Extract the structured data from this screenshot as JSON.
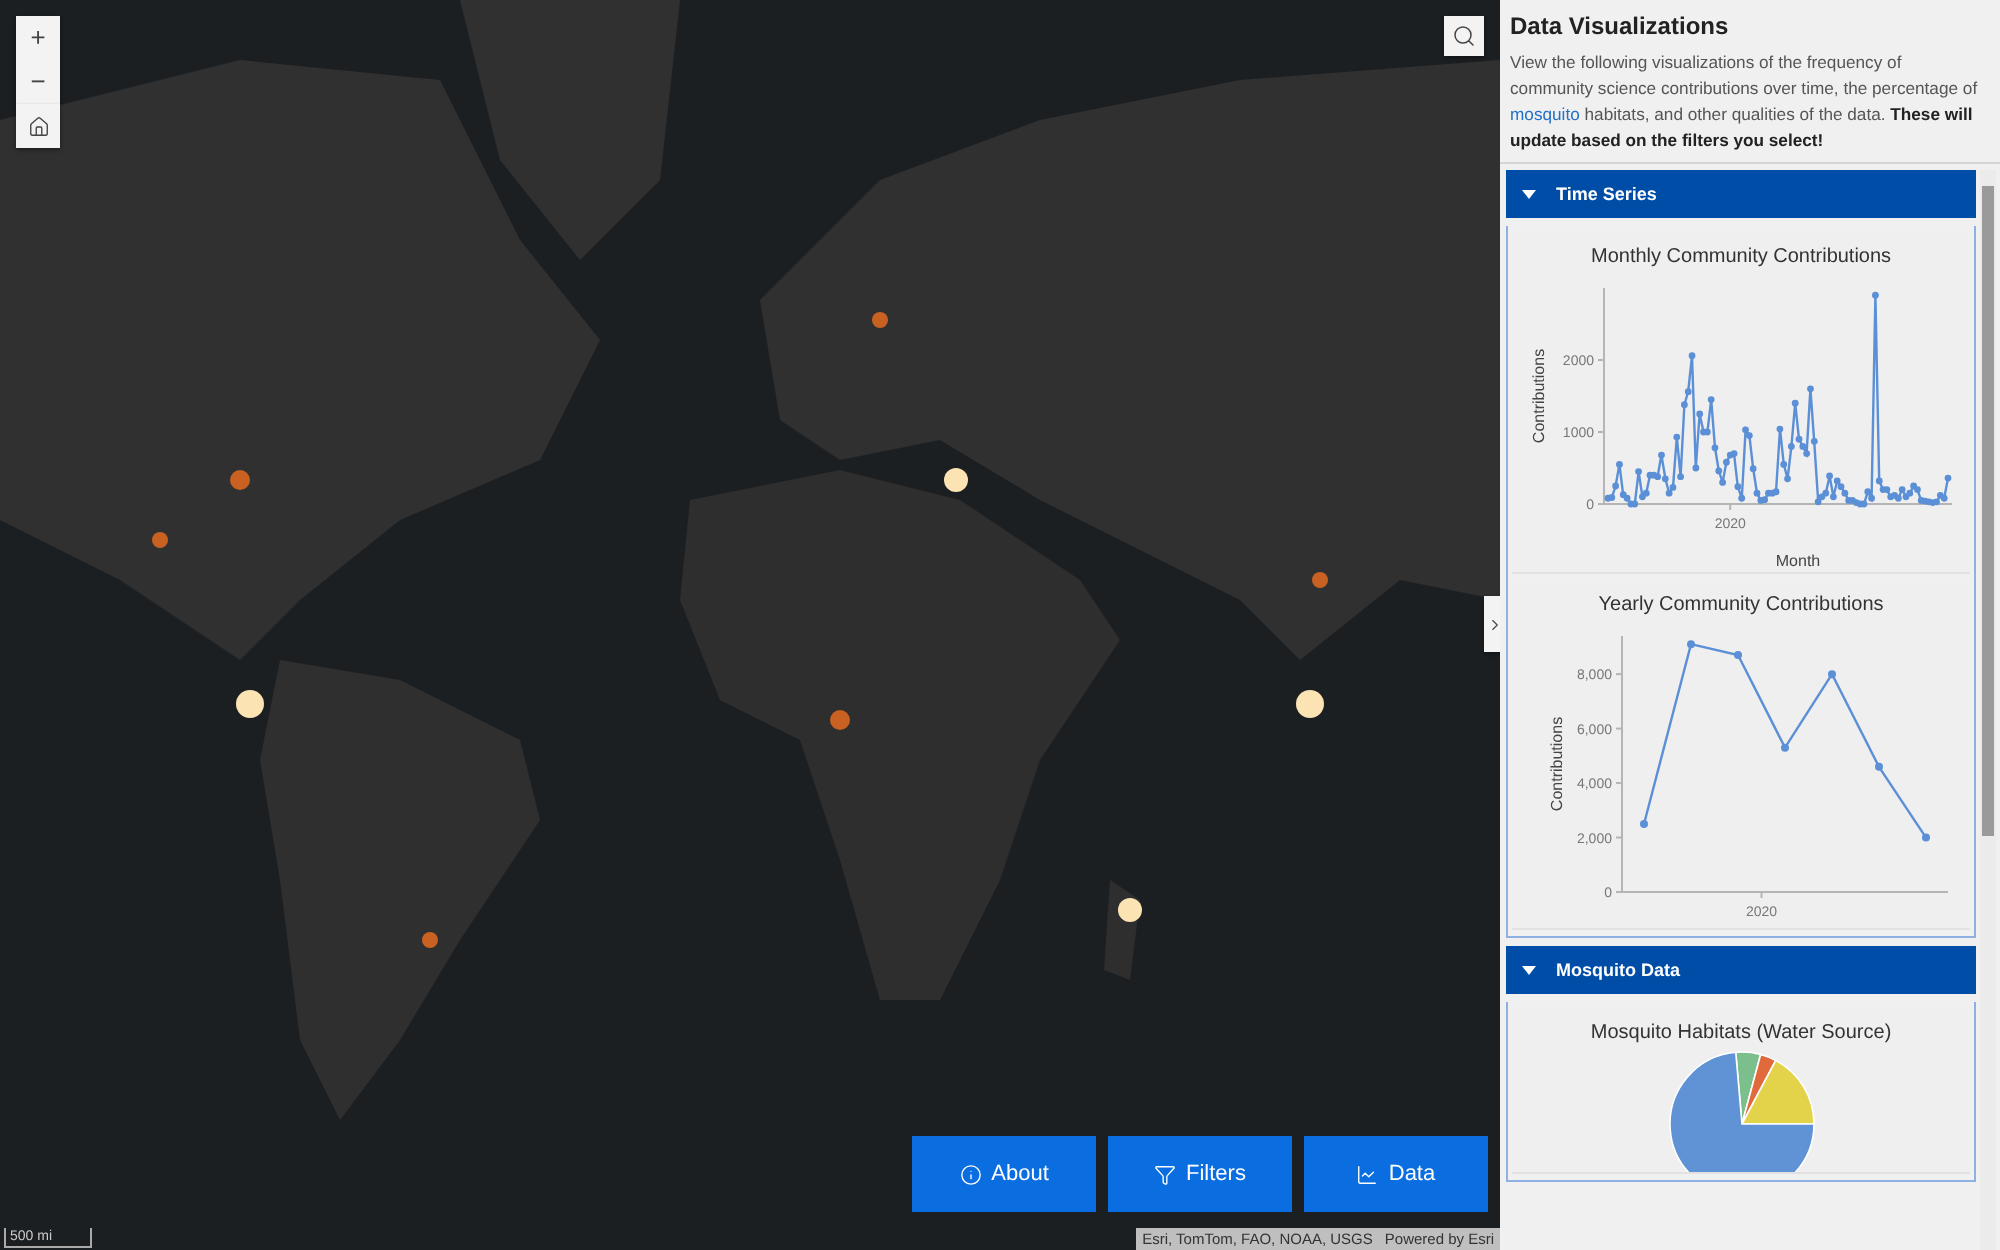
{
  "map": {
    "zoom_in": "+",
    "zoom_out": "−",
    "scale": "500 mi",
    "attribution": "Esri, TomTom, FAO, NOAA, USGS",
    "powered_by": "Powered by Esri",
    "buttons": [
      {
        "label": "About",
        "kind": "info"
      },
      {
        "label": "Filters",
        "kind": "filter"
      },
      {
        "label": "Data",
        "kind": "chart"
      }
    ]
  },
  "panel": {
    "title": "Data Visualizations",
    "description": {
      "before": "View the following visualizations of the frequency of community science contributions over time, the percentage of",
      "link": "mosquito",
      "after": "habitats, and other qualities of the data. **These will update based on the filters you select!**"
    },
    "sections": [
      {
        "title": "Time Series",
        "expanded": true,
        "charts": [
          {
            "chart_data": {
              "type": "line",
              "title": "Monthly Community Contributions",
              "xlabel": "Month",
              "ylabel": "Contributions",
              "ylim": [
                0,
                3000
              ],
              "yticks": [
                {
                  "value": 0,
                  "label": "0"
                },
                {
                  "value": 1000,
                  "label": "1000"
                },
                {
                  "value": 2000,
                  "label": "2000"
                }
              ],
              "annotations": [
                "2020"
              ],
              "series": [
                {
                  "color": "#5b8fd6",
                  "marker": "circle",
                  "values": [
                    80,
                    90,
                    250,
                    550,
                    130,
                    80,
                    0,
                    0,
                    450,
                    100,
                    150,
                    400,
                    400,
                    380,
                    680,
                    350,
                    150,
                    230,
                    930,
                    380,
                    1380,
                    1560,
                    2060,
                    500,
                    1250,
                    1000,
                    1000,
                    1450,
                    780,
                    460,
                    300,
                    580,
                    680,
                    700,
                    240,
                    80,
                    1030,
                    950,
                    490,
                    150,
                    50,
                    60,
                    150,
                    150,
                    170,
                    1040,
                    550,
                    350,
                    800,
                    1400,
                    900,
                    800,
                    700,
                    1600,
                    870,
                    30,
                    100,
                    150,
                    390,
                    100,
                    320,
                    240,
                    150,
                    50,
                    50,
                    20,
                    0,
                    0,
                    170,
                    80,
                    2900,
                    320,
                    200,
                    200,
                    100,
                    120,
                    80,
                    200,
                    100,
                    150,
                    250,
                    200,
                    50,
                    40,
                    30,
                    20,
                    30,
                    120,
                    80,
                    360
                  ]
                }
              ]
            }
          },
          {
            "chart_data": {
              "type": "line",
              "title": "Yearly Community Contributions",
              "ylabel": "Contributions",
              "ylim": [
                0,
                9400
              ],
              "yticks": [
                {
                  "value": 0,
                  "label": "0"
                },
                {
                  "value": 2000,
                  "label": "2,000"
                },
                {
                  "value": 4000,
                  "label": "4,000"
                },
                {
                  "value": 6000,
                  "label": "6,000"
                },
                {
                  "value": 8000,
                  "label": "8,000"
                }
              ],
              "annotations": [
                "2020"
              ],
              "series": [
                {
                  "color": "#5b8fd6",
                  "marker": "circle",
                  "values": [
                    2500,
                    9100,
                    8700,
                    5300,
                    8000,
                    4600,
                    2000
                  ]
                }
              ]
            }
          }
        ]
      },
      {
        "title": "Mosquito Data",
        "expanded": true,
        "charts": [
          {
            "kind": "pie",
            "title": "Mosquito Habitats (Water Source)"
          }
        ]
      }
    ]
  }
}
